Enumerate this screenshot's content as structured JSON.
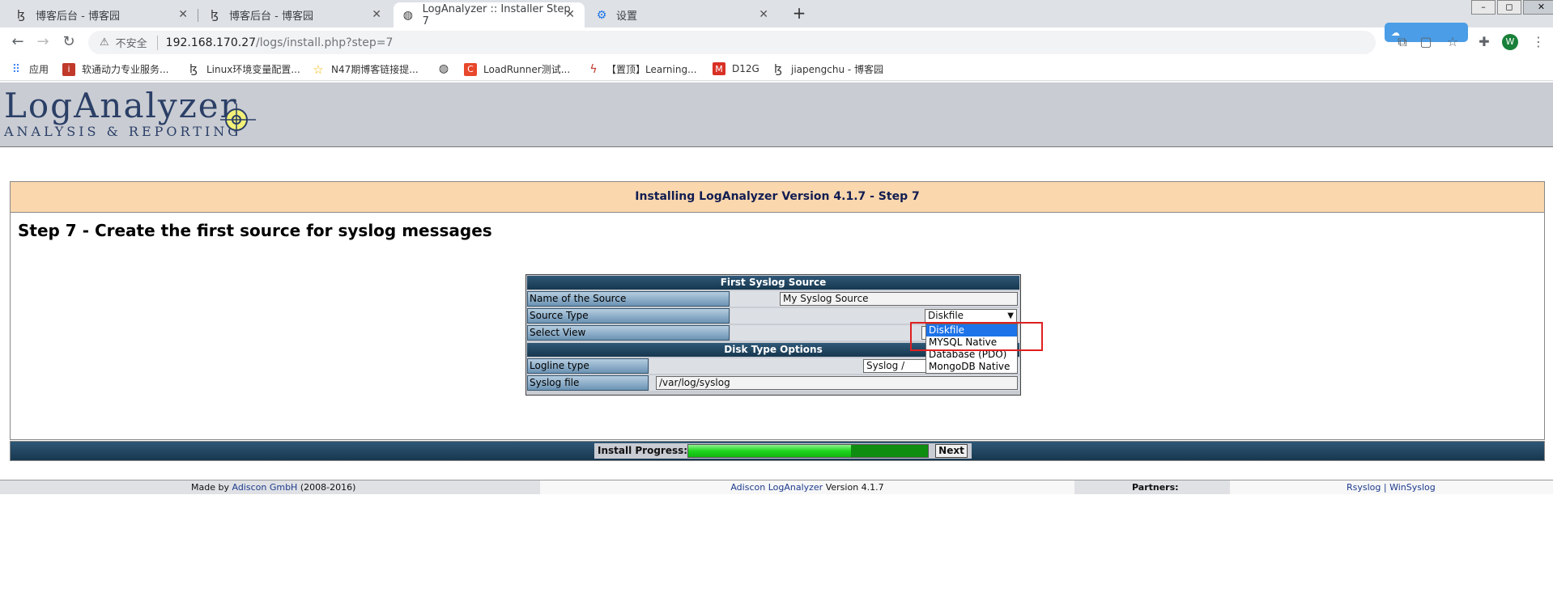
{
  "browser": {
    "tabs": [
      {
        "title": "博客后台 - 博客园",
        "active": false
      },
      {
        "title": "博客后台 - 博客园",
        "active": false
      },
      {
        "title": "LogAnalyzer :: Installer Step 7",
        "active": true
      },
      {
        "title": "设置",
        "active": false
      }
    ],
    "address": {
      "insecure_label": "不安全",
      "host": "192.168.170.27",
      "path": "/logs/install.php?step=7"
    },
    "bookmarks": [
      {
        "label": "应用",
        "icon": "apps-grid-icon",
        "color": "#4285f4"
      },
      {
        "label": "软通动力专业服务...",
        "icon": "isoftstone-icon",
        "color": "#c0392b"
      },
      {
        "label": "Linux环境变量配置...",
        "icon": "cnblogs-icon",
        "color": "#333333"
      },
      {
        "label": "N47期博客链接提...",
        "icon": "star-icon",
        "color": "#f2b705"
      },
      {
        "label": "",
        "icon": "globe-icon",
        "color": "#333333"
      },
      {
        "label": "LoadRunner测试...",
        "icon": "csdn-icon",
        "color": "#e8472b"
      },
      {
        "label": "【置顶】Learning...",
        "icon": "bird-icon",
        "color": "#c0392b"
      },
      {
        "label": "D12G",
        "icon": "gmail-icon",
        "color": "#d93025"
      },
      {
        "label": "jiapengchu - 博客园",
        "icon": "cnblogs-icon",
        "color": "#333333"
      }
    ],
    "avatar_letter": "W"
  },
  "app": {
    "logo_title": "LogAnalyzer",
    "logo_subtitle": "ANALYSIS & REPORTING",
    "install_title": "Installing LogAnalyzer Version 4.1.7 - Step 7",
    "step_heading": "Step 7 - Create the first source for syslog messages",
    "form": {
      "section1_title": "First Syslog Source",
      "name_label": "Name of the Source",
      "name_value": "My Syslog Source",
      "source_type_label": "Source Type",
      "source_type_value": "Diskfile",
      "select_view_label": "Select View",
      "section2_title": "Disk Type Options",
      "logline_label": "Logline type",
      "logline_value": "Syslog / RSys",
      "syslog_file_label": "Syslog file",
      "syslog_file_value": "/var/log/syslog"
    },
    "dropdown_options": [
      "Diskfile",
      "MYSQL Native",
      "Database (PDO)",
      "MongoDB Native"
    ],
    "dropdown_selected": 0,
    "progress": {
      "label": "Install Progress:",
      "fraction": 0.68
    },
    "next_label": "Next",
    "footer": {
      "made_by_prefix": "Made by",
      "made_by_link": "Adiscon GmbH",
      "made_by_years": "(2008-2016)",
      "product_link": "Adiscon LogAnalyzer",
      "product_version": "Version 4.1.7",
      "partners_label": "Partners:",
      "partner1": "Rsyslog",
      "partner_sep": "|",
      "partner2": "WinSyslog"
    }
  }
}
